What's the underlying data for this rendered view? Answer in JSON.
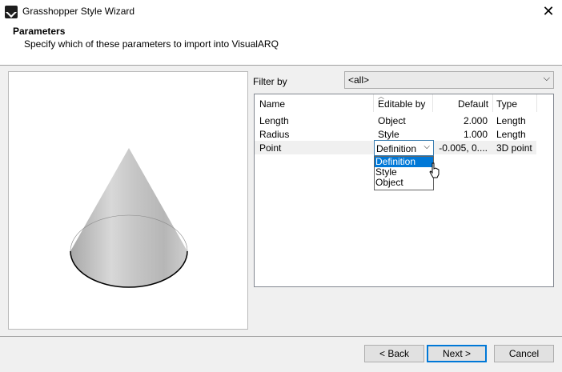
{
  "window": {
    "title": "Grasshopper Style Wizard",
    "close_glyph": "✕"
  },
  "header": {
    "title": "Parameters",
    "subtitle": "Specify which of these parameters to import into VisualARQ"
  },
  "preview": {
    "object": "cone",
    "fill": "#c4c4c4"
  },
  "filter": {
    "label": "Filter by",
    "value": "<all>",
    "arrow": "⌵"
  },
  "grid": {
    "columns": [
      "Name",
      "Editable by",
      "Default",
      "Type"
    ],
    "rows": [
      {
        "name": "Length",
        "editable_by": "Object",
        "default": "2.000",
        "type": "Length"
      },
      {
        "name": "Radius",
        "editable_by": "Style",
        "default": "1.000",
        "type": "Length"
      },
      {
        "name": "Point",
        "editable_by": "Definition",
        "default": "-0.005, 0....",
        "type": "3D point"
      }
    ],
    "dropdown": {
      "current": "Definition",
      "arrow": "⌵",
      "options": [
        "Definition",
        "Style",
        "Object"
      ],
      "selected": "Definition"
    }
  },
  "buttons": {
    "back": "< Back",
    "next": "Next >",
    "cancel": "Cancel"
  },
  "colors": {
    "accent": "#0078d7",
    "window_bg": "#f0f0f0"
  }
}
